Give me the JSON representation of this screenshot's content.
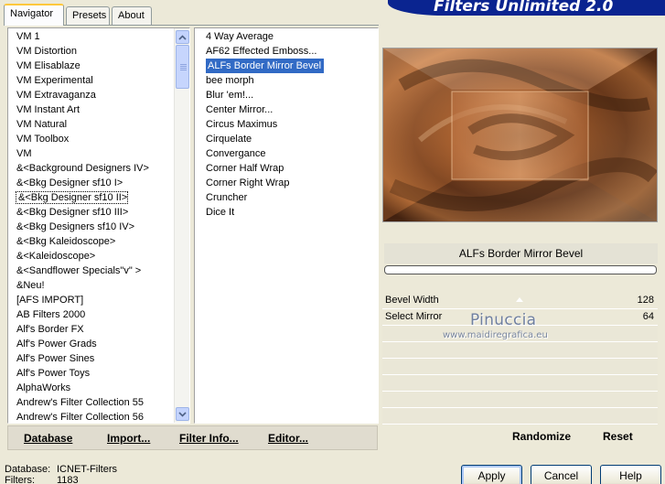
{
  "banner": {
    "title": "Filters Unlimited 2.0"
  },
  "tabs": [
    {
      "label": "Navigator",
      "active": true
    },
    {
      "label": "Presets",
      "active": false
    },
    {
      "label": "About",
      "active": false
    }
  ],
  "categories": {
    "selected_index": 11,
    "items": [
      "VM 1",
      "VM Distortion",
      "VM Elisablaze",
      "VM Experimental",
      "VM Extravaganza",
      "VM Instant Art",
      "VM Natural",
      "VM Toolbox",
      "VM",
      "&<Background Designers IV>",
      "&<Bkg Designer sf10 I>",
      "&<Bkg Designer sf10 II>",
      "&<Bkg Designer sf10 III>",
      "&<Bkg Designers sf10 IV>",
      "&<Bkg Kaleidoscope>",
      "&<Kaleidoscope>",
      "&<Sandflower Specials\"v\" >",
      "&Neu!",
      "[AFS IMPORT]",
      "AB Filters 2000",
      "Alf's Border FX",
      "Alf's Power Grads",
      "Alf's Power Sines",
      "Alf's Power Toys",
      "AlphaWorks",
      "Andrew's Filter Collection 55",
      "Andrew's Filter Collection 56"
    ]
  },
  "filters": {
    "selected_index": 2,
    "items": [
      "4 Way Average",
      "AF62 Effected Emboss...",
      "ALFs Border Mirror Bevel",
      "bee morph",
      "Blur 'em!...",
      "Center Mirror...",
      "Circus Maximus",
      "Cirquelate",
      "Convergance",
      "Corner Half Wrap",
      "Corner Right Wrap",
      "Cruncher",
      "Dice It"
    ]
  },
  "toolbar": {
    "database": "Database",
    "import": "Import...",
    "filter_info": "Filter Info...",
    "editor": "Editor..."
  },
  "preview": {
    "filter_name": "ALFs Border Mirror Bevel",
    "progress": 0
  },
  "params": [
    {
      "label": "Bevel Width",
      "value": "128"
    },
    {
      "label": "Select Mirror",
      "value": "64"
    }
  ],
  "watermark": {
    "name": "Pinuccia",
    "url": "www.maidiregrafica.eu"
  },
  "actions": {
    "randomize": "Randomize",
    "reset": "Reset"
  },
  "status": {
    "database_label": "Database:",
    "database_value": "ICNET-Filters",
    "filters_label": "Filters:",
    "filters_value": "1183"
  },
  "buttons": {
    "apply": "Apply",
    "cancel": "Cancel",
    "help": "Help"
  },
  "icons": {
    "scroll_up": "chevron-up-icon",
    "scroll_down": "chevron-down-icon"
  },
  "colors": {
    "selection": "#316ac5",
    "banner": "#0a2490",
    "window": "#ece9d8"
  }
}
